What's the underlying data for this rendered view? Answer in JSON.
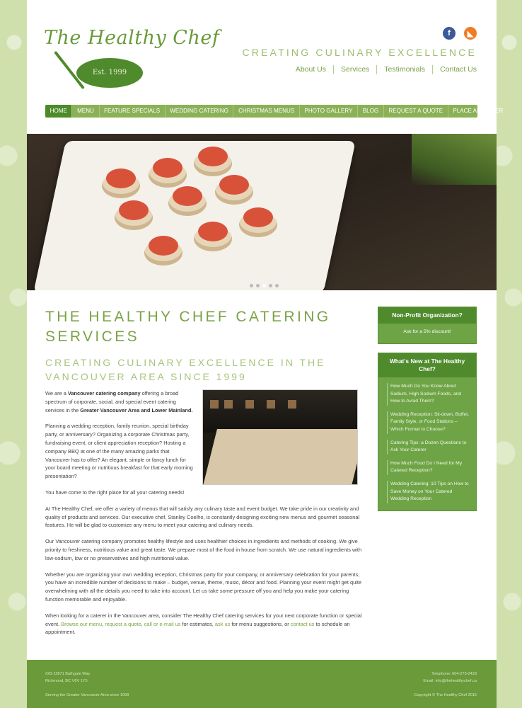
{
  "header": {
    "logo_text": "The Healthy Chef",
    "logo_plate": "Est. 1999",
    "tagline": "CREATING CULINARY EXCELLENCE",
    "social": [
      {
        "icon": "facebook-icon",
        "glyph": "f"
      },
      {
        "icon": "rss-icon",
        "glyph": "◣"
      }
    ],
    "top_links": [
      "About Us",
      "Services",
      "Testimonials",
      "Contact Us"
    ]
  },
  "nav": {
    "items": [
      "HOME",
      "MENU",
      "FEATURE SPECIALS",
      "WEDDING CATERING",
      "CHRISTMAS MENUS",
      "PHOTO GALLERY",
      "BLOG",
      "REQUEST A QUOTE",
      "PLACE AN ORDER"
    ],
    "active": 0
  },
  "slider": {
    "dots": 5,
    "active": 2
  },
  "main": {
    "title": "THE HEALTHY CHEF CATERING SERVICES",
    "subtitle": "CREATING CULINARY EXCELLENCE IN THE VANCOUVER AREA SINCE 1999",
    "p1": {
      "a": "We are a ",
      "b1": "Vancouver catering company",
      "c": " offering a broad spectrum of corporate, social, and special event catering services in the ",
      "b2": "Greater Vancouver Area and Lower Mainland."
    },
    "p2": "Planning a wedding reception, family reunion, special birthday party, or anniversary? Organizing a corporate Christmas party, fundraising event, or client appreciation reception? Hosting a company BBQ at one of the many amazing parks that Vancouver has to offer? An elegant, simple or fancy lunch for your board meeting or nutritious breakfast for that early morning presentation?",
    "p3": "You have come to the right place for all your catering needs!",
    "p4": "At The Healthy Chef, we offer a variety of menus that will satisfy any culinary taste and event budget. We take pride in our creativity and quality of products and services. Our executive chef, Stanley Coelho, is constantly designing exciting new menus and gourmet seasonal features. He will be glad to customize any menu to meet your catering and culinary needs.",
    "p5": "Our Vancouver catering company promotes healthy lifestyle and uses healthier choices in ingredients and methods of cooking. We give priority to freshness, nutritious value and great taste. We prepare most of the food in house from scratch. We use natural ingredients with low-sodium, low or no preservatives and high nutritional value.",
    "p6": "Whether you are organizing your own wedding reception, Christmas party for your company, or anniversary celebration for your parents, you have an incredible number of decisions to make – budget, venue, theme, music, décor and food. Planning your event might get quite overwhelming with all the details you need to take into account. Let us take some pressure off you and help you make your catering function memorable and enjoyable.",
    "p7": {
      "a": "When looking for a caterer in the Vancouver area, consider The Healthy Chef catering services for your next corporate function or special event. ",
      "l1": "Browse our menu",
      "s1": ", ",
      "l2": "request a quote",
      "s2": ", ",
      "l3": "call or e-mail us",
      "s3": " for estimates, ",
      "l4": "ask us",
      "s4": " for menu suggestions, or ",
      "l5": "contact us",
      "s5": " to schedule an appointment."
    }
  },
  "sidebar": {
    "box1": {
      "title": "Non-Profit Organization?",
      "body": "Ask for a 5% discount!"
    },
    "box2": {
      "title": "What's New at The Healthy Chef?",
      "items": [
        "How Much Do You Know About Sodium, High Sodium Foods, and How to Avoid Them?",
        "Wedding Reception: Sit-down, Buffet, Family Style, or Food Stations – Which Format to Choose?",
        "Catering Tips: a Dozen Questions to Ask Your Caterer",
        "How Much Food Do I Need for My Catered Reception?",
        "Wedding Catering: 10 Tips on How to Save Money on Your Catered Wedding Reception"
      ]
    }
  },
  "footer": {
    "address1": "#20-12871 Bathgate Way",
    "address2": "Richmond, BC V6V 1Y5",
    "phone": "Telephone: 604-273-2433",
    "email": "Email: info@thehealthychef.ca",
    "serving": "Serving the Greater Vancouver Area since 1999",
    "copyright": "Copyright © The Healthy Chef 2015"
  },
  "colors": {
    "brand_green": "#6a9a3a",
    "nav_green": "#8bb157",
    "active_nav": "#4d8a2a",
    "facebook": "#3b5a98",
    "rss": "#f07b22"
  }
}
